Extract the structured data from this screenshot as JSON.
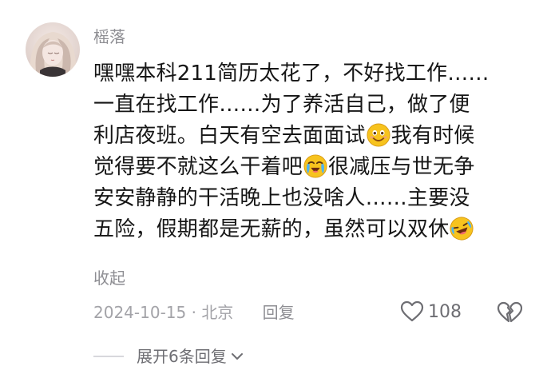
{
  "comment": {
    "username": "榣落",
    "lines": [
      {
        "parts": [
          "嘿嘿本科211简历太花了，不好找工作……"
        ]
      },
      {
        "parts": [
          "一直在找工作……为了养活自己，做了便"
        ]
      },
      {
        "parts": [
          "利店夜班。白天有空去面面试",
          "我有时候"
        ],
        "emoji": "smile-emoji-icon"
      },
      {
        "parts": [
          "觉得要不就这么干着吧",
          "很减压与世无争"
        ],
        "emoji": "crying-emoji-icon"
      },
      {
        "parts": [
          "安安静静的干活晚上也没啥人……主要没"
        ]
      },
      {
        "parts": [
          "五险，假期都是无薪的，虽然可以双休",
          ""
        ],
        "emoji": "rofl-emoji-icon"
      }
    ],
    "collapse_label": "收起",
    "date": "2024-10-15",
    "separator": "·",
    "location": "北京",
    "reply_label": "回复",
    "like_count": "108",
    "expand_label": "展开6条回复"
  },
  "colors": {
    "text": "#161616",
    "muted": "#8e8e93",
    "emoji_yellow": "#f7c31e"
  }
}
